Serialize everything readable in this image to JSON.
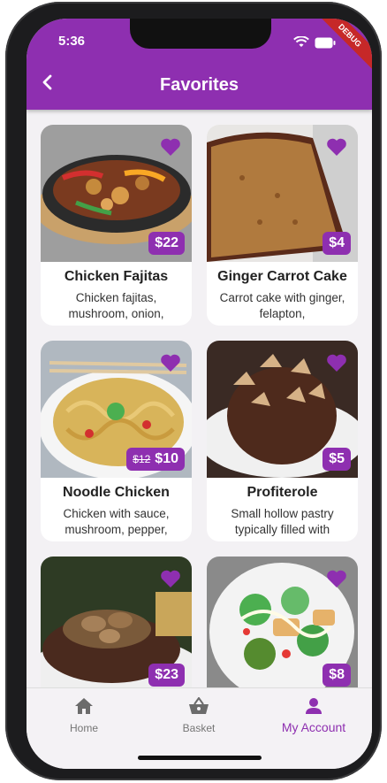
{
  "status_bar": {
    "time": "5:36",
    "debug_banner": "DEBUG"
  },
  "header": {
    "title": "Favorites"
  },
  "favorites": [
    {
      "name": "Chicken Fajitas",
      "description": "Chicken fajitas, mushroom, onion,",
      "price": "$22",
      "old_price": ""
    },
    {
      "name": "Ginger Carrot Cake",
      "description": "Carrot cake with ginger, felapton,",
      "price": "$4",
      "old_price": ""
    },
    {
      "name": "Noodle Chicken",
      "description": "Chicken with sauce, mushroom, pepper,",
      "price": "$10",
      "old_price": "$12"
    },
    {
      "name": "Profiterole",
      "description": "Small hollow pastry typically filled with",
      "price": "$5",
      "old_price": ""
    },
    {
      "name": "",
      "description": "",
      "price": "$23",
      "old_price": ""
    },
    {
      "name": "",
      "description": "",
      "price": "$8",
      "old_price": ""
    }
  ],
  "bottom_nav": {
    "items": [
      {
        "label": "Home",
        "icon": "home-icon"
      },
      {
        "label": "Basket",
        "icon": "basket-icon"
      },
      {
        "label": "My Account",
        "icon": "account-icon"
      }
    ],
    "active": "My Account"
  },
  "colors": {
    "accent": "#8e2fb0"
  }
}
